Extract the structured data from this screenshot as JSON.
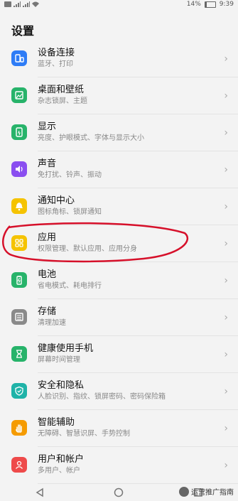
{
  "status": {
    "battery_percent": "14%",
    "battery_level": 0.14,
    "time": "9:39",
    "left_icons": [
      "notification-icon",
      "signal-icon",
      "signal-icon",
      "wifi-icon"
    ]
  },
  "page_title": "设置",
  "items": [
    {
      "title": "设备连接",
      "subtitle": "蓝牙、打印",
      "icon": "devices-icon",
      "color": "#2e7cf6"
    },
    {
      "title": "桌面和壁纸",
      "subtitle": "杂志锁屏、主题",
      "icon": "wallpaper-icon",
      "color": "#27b36a"
    },
    {
      "title": "显示",
      "subtitle": "亮度、护眼模式、字体与显示大小",
      "icon": "display-icon",
      "color": "#27b36a"
    },
    {
      "title": "声音",
      "subtitle": "免打扰、铃声、振动",
      "icon": "sound-icon",
      "color": "#8a4ef0"
    },
    {
      "title": "通知中心",
      "subtitle": "图标角标、锁屏通知",
      "icon": "notification-icon",
      "color": "#f5c300"
    },
    {
      "title": "应用",
      "subtitle": "权限管理、默认应用、应用分身",
      "icon": "apps-icon",
      "color": "#f5c300"
    },
    {
      "title": "电池",
      "subtitle": "省电模式、耗电排行",
      "icon": "battery-icon",
      "color": "#27b36a"
    },
    {
      "title": "存储",
      "subtitle": "清理加速",
      "icon": "storage-icon",
      "color": "#8a8a8a"
    },
    {
      "title": "健康使用手机",
      "subtitle": "屏幕时间管理",
      "icon": "hourglass-icon",
      "color": "#27b36a"
    },
    {
      "title": "安全和隐私",
      "subtitle": "人脸识别、指纹、锁屏密码、密码保险箱",
      "icon": "shield-icon",
      "color": "#1fb3a8"
    },
    {
      "title": "智能辅助",
      "subtitle": "无障碍、智慧识屏、手势控制",
      "icon": "hand-icon",
      "color": "#f59b00"
    },
    {
      "title": "用户和帐户",
      "subtitle": "多用户、帐户",
      "icon": "user-icon",
      "color": "#ee4a4a"
    }
  ],
  "nav": {
    "back": "back-icon",
    "home": "home-icon",
    "recents": "recents-icon"
  },
  "watermark": "运营推广指南",
  "accent_annotation_color": "#d6102a"
}
